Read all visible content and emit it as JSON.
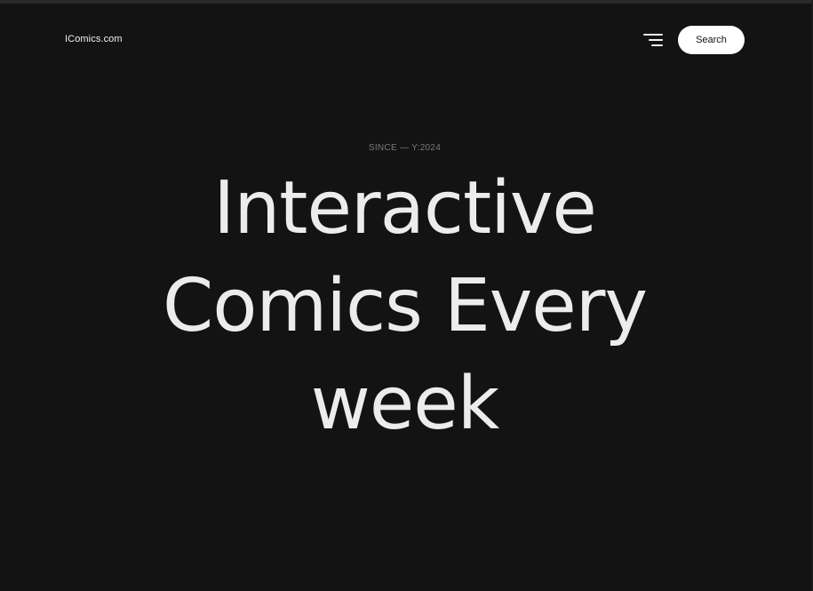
{
  "header": {
    "logo_text": "IComics.com",
    "search_label": "Search"
  },
  "hero": {
    "eyebrow": "SINCE — Y:2024",
    "title_lines": [
      "Interactive",
      "Comics Every",
      "week"
    ]
  },
  "colors": {
    "background": "#131313",
    "text": "#ececec",
    "muted": "#7a7a7a",
    "button_bg": "#ffffff",
    "button_text": "#111111"
  },
  "icons": {
    "menu": "hamburger-menu-icon"
  }
}
